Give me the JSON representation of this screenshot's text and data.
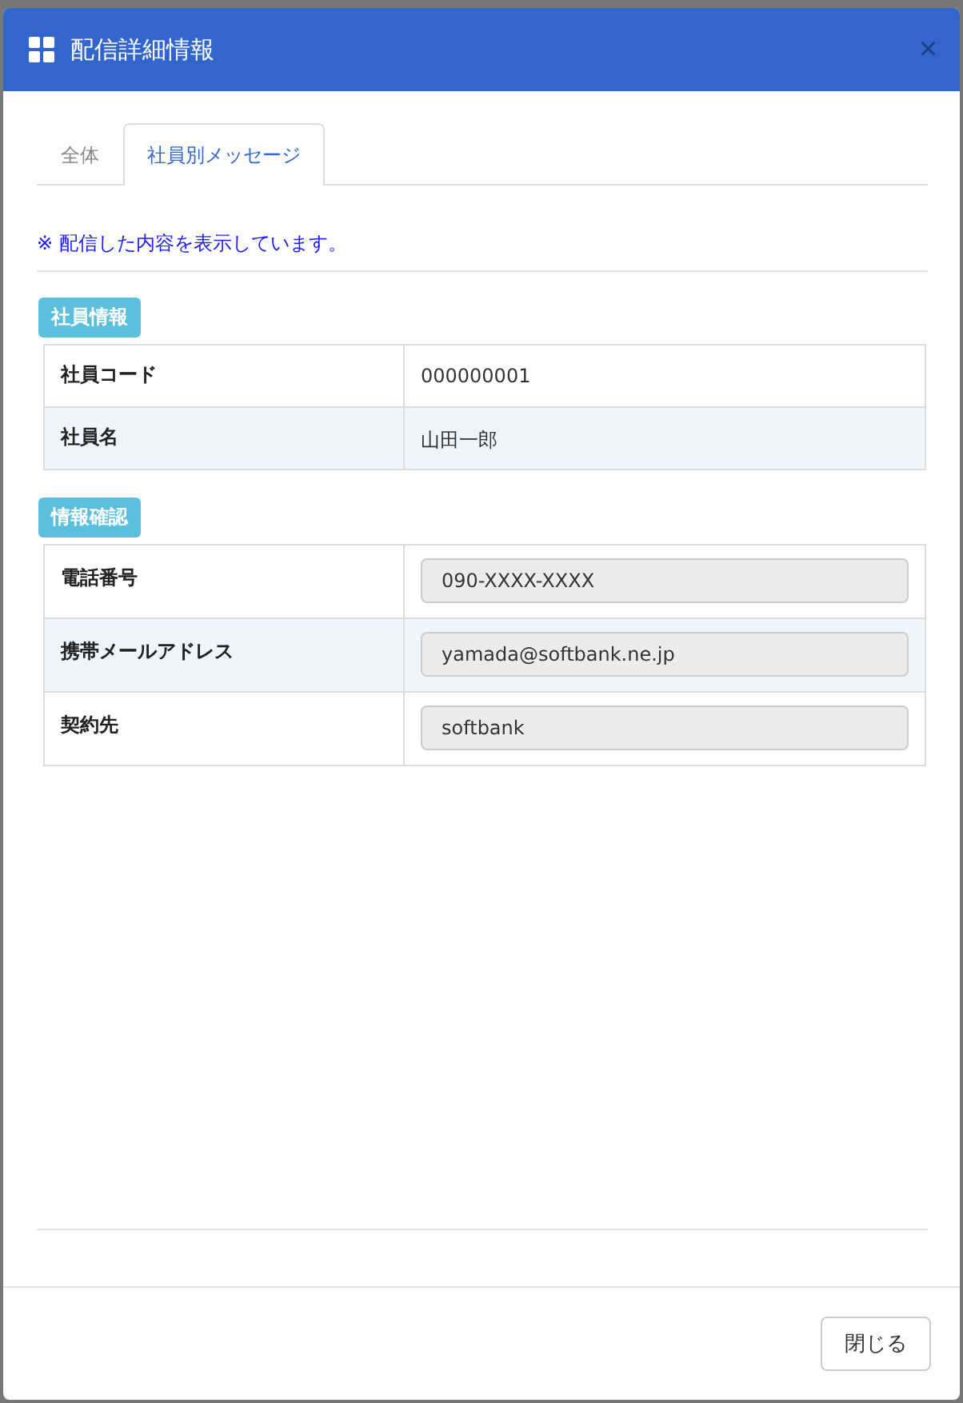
{
  "dialog": {
    "title": "配信詳細情報",
    "close_label": "×"
  },
  "tabs": [
    {
      "label": "全体",
      "selected": false
    },
    {
      "label": "社員別メッセージ",
      "selected": true
    }
  ],
  "note": "※ 配信した内容を表示しています。",
  "sections": [
    {
      "heading": "社員情報",
      "rows": [
        {
          "label": "社員コード",
          "kind": "text",
          "value": "000000001"
        },
        {
          "label": "社員名",
          "kind": "text",
          "value": "山田一郎"
        }
      ]
    },
    {
      "heading": "情報確認",
      "rows": [
        {
          "label": "電話番号",
          "kind": "input",
          "value": "090-XXXX-XXXX"
        },
        {
          "label": "携帯メールアドレス",
          "kind": "input",
          "value": "yamada@softbank.ne.jp"
        },
        {
          "label": "契約先",
          "kind": "input",
          "value": "softbank"
        }
      ]
    }
  ],
  "buttons": [
    "閉じる"
  ]
}
